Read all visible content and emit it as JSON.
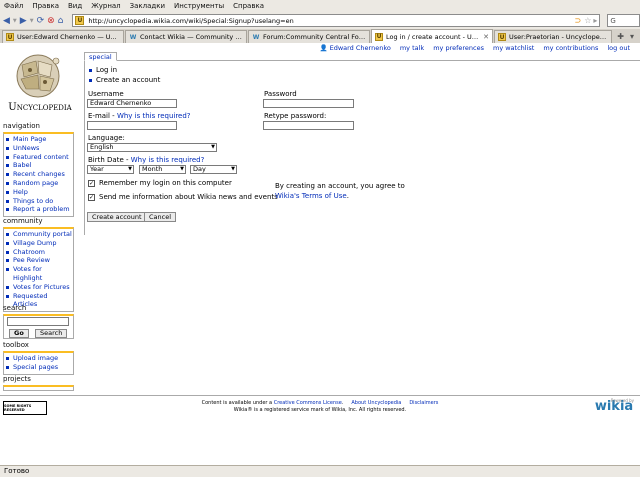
{
  "browser": {
    "menu": [
      "Файл",
      "Правка",
      "Вид",
      "Журнал",
      "Закладки",
      "Инструменты",
      "Справка"
    ],
    "url": "http://uncyclopedia.wikia.com/wiki/Special:Signup?uselang=en",
    "tabs": [
      {
        "icon": "U",
        "title": "User:Edward Chernenko — U..."
      },
      {
        "icon": "W",
        "title": "Contact Wikia — Community C..."
      },
      {
        "icon": "W",
        "title": "Forum:Community Central For..."
      },
      {
        "icon": "U",
        "title": "Log in / create account - Unc..."
      },
      {
        "icon": "U",
        "title": "User:Praetorian - Uncycloped..."
      }
    ],
    "status": "Готово"
  },
  "wiki": {
    "logo_text": "Uncyclopedia",
    "page_tab": "special",
    "personal_tools": {
      "user": "Edward Chernenko",
      "talk": "my talk",
      "preferences": "my preferences",
      "watchlist": "my watchlist",
      "contributions": "my contributions",
      "logout": "log out"
    },
    "sidebar": {
      "navigation": {
        "title": "navigation",
        "items": [
          "Main Page",
          "UnNews",
          "Featured content",
          "Babel",
          "Recent changes",
          "Random page",
          "Help",
          "Things to do",
          "Report a problem"
        ]
      },
      "community": {
        "title": "community",
        "items": [
          "Community portal",
          "Village Dump",
          "Chatroom",
          "Pee Review",
          "Votes for Highlight",
          "Votes for Pictures",
          "Requested Articles"
        ]
      },
      "search": {
        "title": "search",
        "value": "",
        "go": "Go",
        "search": "Search"
      },
      "toolbox": {
        "title": "toolbox",
        "items": [
          "Upload image",
          "Special pages"
        ]
      },
      "projects": {
        "title": "projects"
      }
    }
  },
  "form": {
    "links": [
      "Log in",
      "Create an account"
    ],
    "username_label": "Username",
    "username_value": "Edward Chernenko",
    "password_label": "Password",
    "email_label": "E-mail - ",
    "email_why": "Why is this required?",
    "retype_label": "Retype password:",
    "language_label": "Language:",
    "language_value": "English",
    "birth_label": "Birth Date - ",
    "birth_why": "Why is this required?",
    "year": "Year",
    "month": "Month",
    "day": "Day",
    "remember": "Remember my login on this computer",
    "newsletter": "Send me information about Wikia news and events",
    "agree_line1": "By creating an account, you agree to",
    "agree_line2_prefix": "Wikia's ",
    "agree_link": "Terms of Use",
    "agree_suffix": ".",
    "create_button": "Create account",
    "cancel_button": "Cancel"
  },
  "footer": {
    "cc_badge": "SOME RIGHTS RESERVED",
    "line1_prefix": "Content is available under a ",
    "line1_link": "Creative Commons License",
    "line1_suffix": ".",
    "about": "About Uncyclopedia",
    "disclaimers": "Disclaimers",
    "line2": "Wikia® is a registered service mark of Wikia, Inc. All rights reserved.",
    "wikia_logo": "wikia",
    "powered_by": "Powered by"
  }
}
